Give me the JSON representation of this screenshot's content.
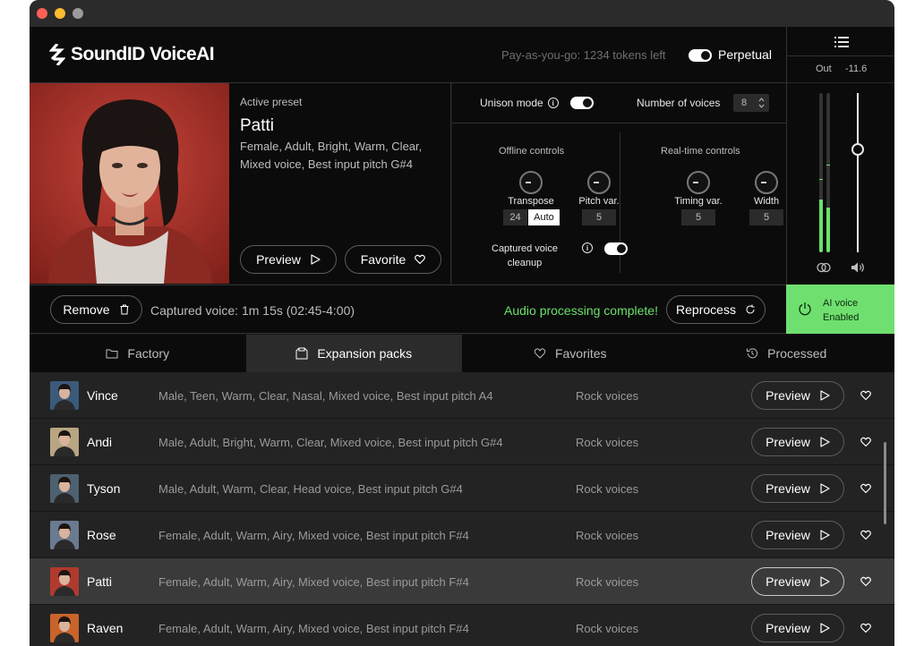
{
  "app": {
    "brand": "SoundID VoiceAI",
    "tokens_text": "Pay-as-you-go: 1234 tokens left",
    "perpetual_label": "Perpetual",
    "perpetual_on": true
  },
  "meter": {
    "out_label": "Out",
    "out_value": "-11.6",
    "left_level": 0.33,
    "right_level": 0.28
  },
  "preset": {
    "label": "Active preset",
    "name": "Patti",
    "tags": "Female, Adult, Bright, Warm, Clear, Mixed voice, Best input pitch  G#4",
    "preview_label": "Preview",
    "favorite_label": "Favorite"
  },
  "controls": {
    "unison_label": "Unison mode",
    "unison_on": true,
    "voices_label": "Number of voices",
    "voices_value": "8",
    "offline_label": "Offline controls",
    "realtime_label": "Real-time controls",
    "transpose_label": "Transpose",
    "transpose_value": "24",
    "transpose_auto": "Auto",
    "pitch_var_label": "Pitch var.",
    "pitch_var_value": "5",
    "timing_var_label": "Timing var.",
    "timing_var_value": "5",
    "width_label": "Width",
    "width_value": "5",
    "cleanup_label": "Captured voice cleanup",
    "cleanup_on": true
  },
  "status": {
    "remove_label": "Remove",
    "captured_text": "Captured voice: 1m 15s (02:45-4:00)",
    "processing_text": "Audio processing complete!",
    "reprocess_label": "Reprocess",
    "ai_line1": "AI voice",
    "ai_line2": "Enabled"
  },
  "tabs": [
    {
      "label": "Factory",
      "icon": "folder-icon",
      "active": false
    },
    {
      "label": "Expansion packs",
      "icon": "package-icon",
      "active": true
    },
    {
      "label": "Favorites",
      "icon": "heart-icon",
      "active": false
    },
    {
      "label": "Processed",
      "icon": "history-icon",
      "active": false
    }
  ],
  "voices": [
    {
      "name": "Vince",
      "tags": "Male, Teen, Warm, Clear, Nasal, Mixed voice, Best input pitch  A4",
      "pack": "Rock voices",
      "preview": "Preview",
      "selected": false,
      "color": "#3b5a7a"
    },
    {
      "name": "Andi",
      "tags": "Male, Adult, Bright, Warm, Clear, Mixed voice, Best input pitch  G#4",
      "pack": "Rock voices",
      "preview": "Preview",
      "selected": false,
      "color": "#b8a682"
    },
    {
      "name": "Tyson",
      "tags": "Male, Adult, Warm, Clear, Head voice, Best input pitch  G#4",
      "pack": "Rock voices",
      "preview": "Preview",
      "selected": false,
      "color": "#4d6070"
    },
    {
      "name": "Rose",
      "tags": "Female, Adult, Warm, Airy, Mixed voice, Best input pitch  F#4",
      "pack": "Rock voices",
      "preview": "Preview",
      "selected": false,
      "color": "#6a7a90"
    },
    {
      "name": "Patti",
      "tags": "Female, Adult, Warm, Airy, Mixed voice, Best input pitch  F#4",
      "pack": "Rock voices",
      "preview": "Preview",
      "selected": true,
      "color": "#b03a2e"
    },
    {
      "name": "Raven",
      "tags": "Female, Adult, Warm, Airy, Mixed voice, Best input pitch  F#4",
      "pack": "Rock voices",
      "preview": "Preview",
      "selected": false,
      "color": "#c8642a"
    }
  ]
}
